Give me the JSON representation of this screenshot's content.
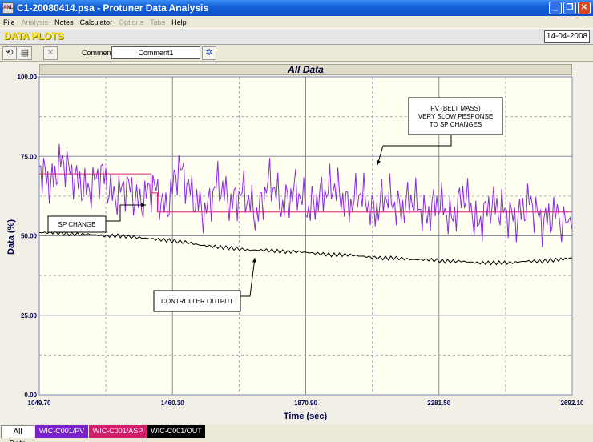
{
  "window": {
    "title": "C1-20080414.psa - Protuner Data  Analysis",
    "icon_text": "ANL"
  },
  "menu": [
    {
      "label": "File",
      "enabled": true
    },
    {
      "label": "Analysis",
      "enabled": false
    },
    {
      "label": "Notes",
      "enabled": true
    },
    {
      "label": "Calculator",
      "enabled": true
    },
    {
      "label": "Options",
      "enabled": false
    },
    {
      "label": "Tabs",
      "enabled": false
    },
    {
      "label": "Help",
      "enabled": true
    }
  ],
  "header": {
    "title": "DATA PLOTS",
    "date": "14-04-2008"
  },
  "toolbar": {
    "comment_label": "Comment",
    "comment_value": "Comment1"
  },
  "tabs": [
    {
      "label": "All Data",
      "bg": "#ffffff",
      "fg": "#000000"
    },
    {
      "label": "WIC-C001/PV",
      "bg": "#7a22c8",
      "fg": "#ffffff"
    },
    {
      "label": "WIC-C001/ASP",
      "bg": "#d0206a",
      "fg": "#ffffff"
    },
    {
      "label": "WIC-C001/OUT",
      "bg": "#000000",
      "fg": "#ffffff"
    }
  ],
  "chart_data": {
    "type": "line",
    "title": "All Data",
    "xlabel": "Time (sec)",
    "ylabel": "Data (%)",
    "xlim": [
      1049.7,
      2692.1
    ],
    "ylim": [
      0,
      100
    ],
    "x_ticks": [
      "1049.70",
      "1460.30",
      "1870.90",
      "2281.50",
      "2692.10"
    ],
    "y_ticks": [
      "0.00",
      "25.00",
      "50.00",
      "75.00",
      "100.00"
    ],
    "grid": true,
    "series": [
      {
        "name": "WIC-C001/PV",
        "color": "#8a2be2",
        "x": [
          1050,
          1085,
          1120,
          1160,
          1200,
          1240,
          1280,
          1320,
          1360,
          1400,
          1440,
          1480,
          1520,
          1560,
          1600,
          1640,
          1680,
          1720,
          1760,
          1800,
          1840,
          1880,
          1920,
          1960,
          2000,
          2040,
          2080,
          2120,
          2160,
          2200,
          2240,
          2280,
          2320,
          2360,
          2400,
          2440,
          2480,
          2520,
          2560,
          2600,
          2640,
          2692
        ],
        "y": [
          72,
          66,
          74,
          68,
          64,
          70,
          62,
          66,
          60,
          66,
          58,
          72,
          63,
          57,
          67,
          60,
          64,
          56,
          68,
          59,
          65,
          58,
          63,
          66,
          59,
          64,
          57,
          63,
          58,
          62,
          56,
          61,
          55,
          64,
          53,
          60,
          58,
          55,
          61,
          54,
          57,
          52
        ]
      },
      {
        "name": "WIC-C001/ASP",
        "color": "#e0207a",
        "x": [
          1049.7,
          1394,
          1394,
          1414,
          1414,
          2692.1
        ],
        "y": [
          69.5,
          69.5,
          63.5,
          63.5,
          57.5,
          57.5
        ]
      },
      {
        "name": "WIC-C001/OUT",
        "color": "#000000",
        "x": [
          1050,
          1100,
          1150,
          1200,
          1250,
          1300,
          1350,
          1400,
          1450,
          1500,
          1550,
          1600,
          1650,
          1700,
          1750,
          1800,
          1850,
          1900,
          1950,
          2000,
          2050,
          2100,
          2150,
          2200,
          2250,
          2300,
          2350,
          2400,
          2450,
          2500,
          2550,
          2600,
          2650,
          2692
        ],
        "y": [
          51,
          51,
          50.5,
          50.5,
          50,
          50,
          49.5,
          49,
          48.5,
          48,
          47,
          46.5,
          46,
          45.5,
          45.5,
          45,
          45,
          44.5,
          44,
          44,
          43.5,
          43,
          43,
          42.5,
          42.5,
          42,
          42,
          41.5,
          41.5,
          41.5,
          42,
          42,
          42.5,
          43
        ]
      }
    ],
    "annotations": [
      {
        "text": [
          "PV (BELT MASS)",
          "VERY SLOW PESPONSE",
          "TO SP CHANGES"
        ]
      },
      {
        "text": [
          "SP CHANGE"
        ]
      },
      {
        "text": [
          "CONTROLLER OUTPUT"
        ]
      }
    ]
  }
}
